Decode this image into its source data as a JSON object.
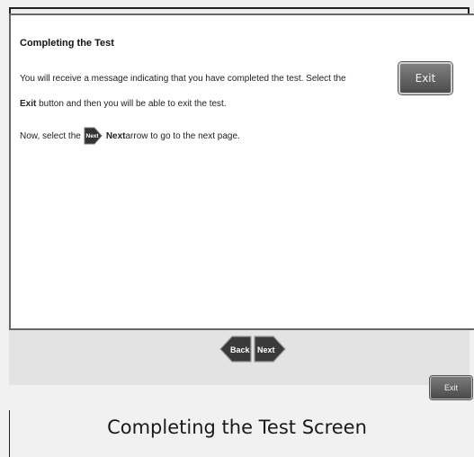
{
  "content": {
    "title": "Completing the Test",
    "line1": "You will receive a message indicating that you have completed the test. Select the",
    "line2_bold": "Exit",
    "line2_rest": " button and then you will be able to exit the test.",
    "line3_start": "Now, select the ",
    "line3_bold": "Next",
    "line3_rest": " arrow to go to the next page.",
    "inline_exit_label": "Exit",
    "inline_next_label": "Next"
  },
  "navigation": {
    "back_label": "Back",
    "next_label": "Next"
  },
  "footer": {
    "exit_label": "Exit"
  },
  "caption": "Completing the Test Screen",
  "colors": {
    "button_dark": "#4c4c4c",
    "panel_bg": "#ffffff",
    "frame_bg": "#ededed"
  }
}
